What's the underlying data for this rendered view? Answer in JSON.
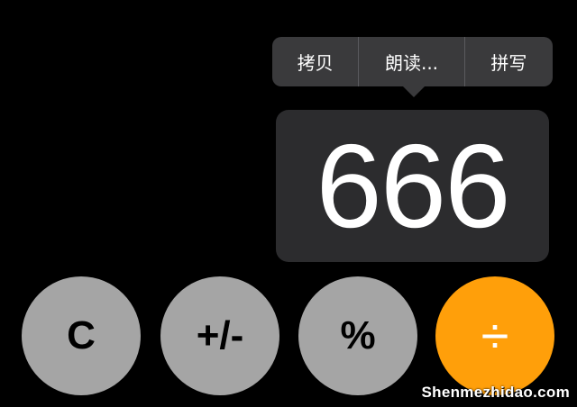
{
  "context_menu": {
    "items": [
      "拷贝",
      "朗读...",
      "拼写"
    ]
  },
  "display": {
    "value": "666"
  },
  "keys": {
    "clear": "C",
    "toggle_sign": "+/-",
    "percent": "%",
    "divide": "÷"
  },
  "colors": {
    "background": "#000000",
    "menu": "#3a3a3c",
    "display_bg": "#2c2c2e",
    "function_key": "#a5a5a5",
    "operator_key": "#ff9f0a"
  },
  "watermark": "Shenmezhidao.com"
}
